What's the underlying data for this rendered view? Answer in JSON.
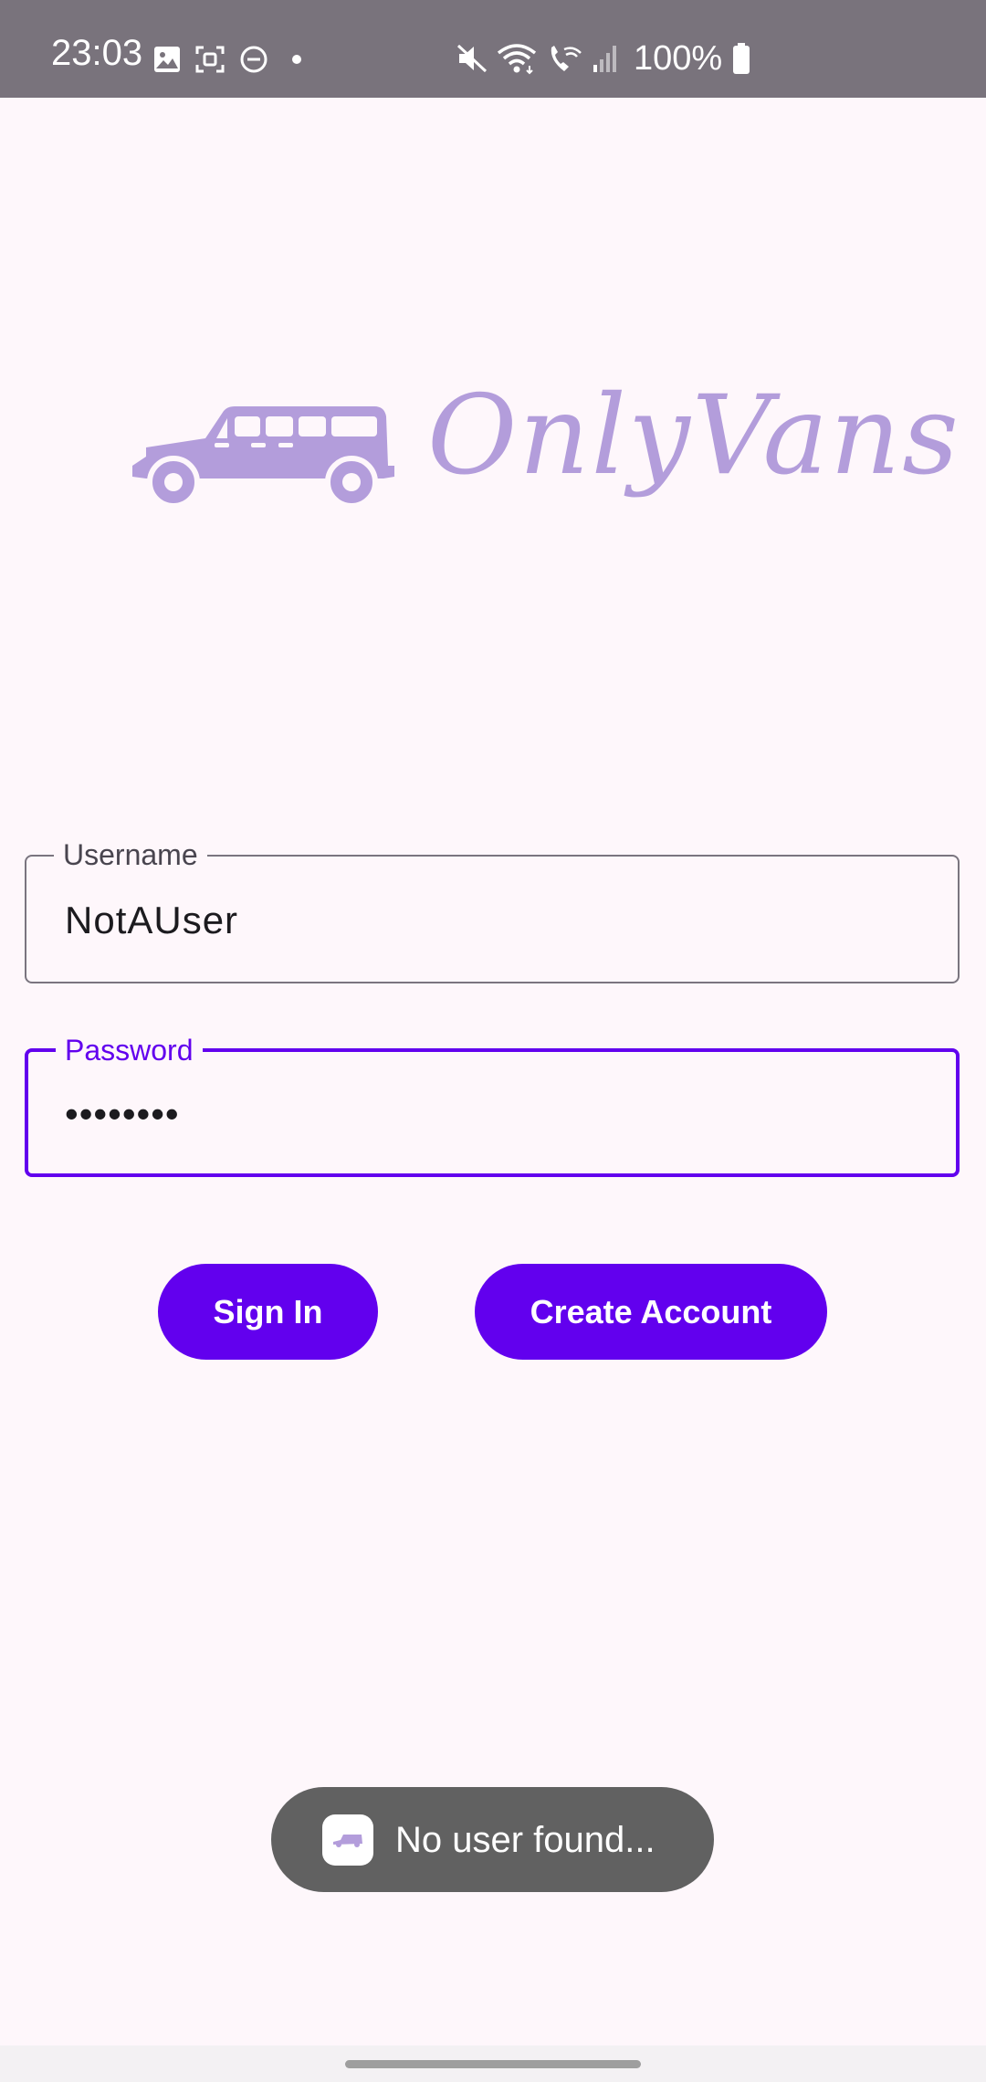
{
  "status_bar": {
    "time": "23:03",
    "battery_percent": "100%",
    "icons_left": [
      "image-icon",
      "screenshot-icon",
      "do-not-disturb-icon",
      "dot-icon"
    ],
    "icons_right": [
      "mute-icon",
      "wifi-icon",
      "wifi-calling-icon",
      "signal-icon",
      "battery-icon"
    ]
  },
  "logo": {
    "text": "OnlyVans",
    "icon": "van-icon",
    "color": "#B39DDB"
  },
  "username_field": {
    "label": "Username",
    "value": "NotAUser"
  },
  "password_field": {
    "label": "Password",
    "value": "••••••••"
  },
  "buttons": {
    "sign_in": "Sign In",
    "create_account": "Create Account"
  },
  "toast": {
    "message": "No user found...",
    "icon": "app-van-icon"
  },
  "colors": {
    "primary": "#6200EE",
    "background": "#FEF7FB",
    "status_bar": "#79737C",
    "toast_bg": "#616161"
  }
}
